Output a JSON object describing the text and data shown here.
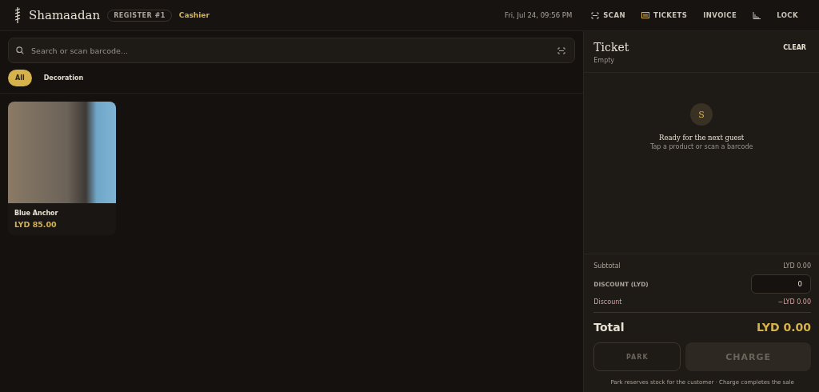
{
  "header": {
    "brand": "Shamaadan",
    "register": "REGISTER #1",
    "role": "Cashier",
    "datetime": "Fri, Jul 24, 09:56 PM",
    "nav": [
      {
        "kind": "scan",
        "label": "SCAN"
      },
      {
        "kind": "tickets",
        "label": "TICKETS"
      },
      {
        "kind": "plain",
        "label": "INVOICE"
      },
      {
        "kind": "chart"
      },
      {
        "kind": "plain",
        "label": "LOCK"
      }
    ]
  },
  "search": {
    "placeholder": "Search or scan barcode..."
  },
  "categories": [
    {
      "label": "All",
      "selected": true
    },
    {
      "label": "Decoration",
      "selected": false
    }
  ],
  "products": [
    {
      "name": "Blue Anchor",
      "price": "LYD 85.00"
    }
  ],
  "ticket": {
    "title": "Ticket",
    "status": "Empty",
    "clear": "CLEAR",
    "avatar": "S",
    "empty_title": "Ready for the next guest",
    "empty_hint": "Tap a product or scan a barcode",
    "subtotal_label": "Subtotal",
    "subtotal": "LYD 0.00",
    "discount_field_label": "DISCOUNT (LYD)",
    "discount_value": "0",
    "discount_label": "Discount",
    "discount": "−LYD 0.00",
    "total_label": "Total",
    "total": "LYD 0.00",
    "buttons": [
      {
        "kind": "park",
        "label": "PARK",
        "disabled": true
      },
      {
        "kind": "charge",
        "label": "CHARGE",
        "disabled": true
      }
    ],
    "note": "Park reserves stock for the customer · Charge completes the sale"
  }
}
